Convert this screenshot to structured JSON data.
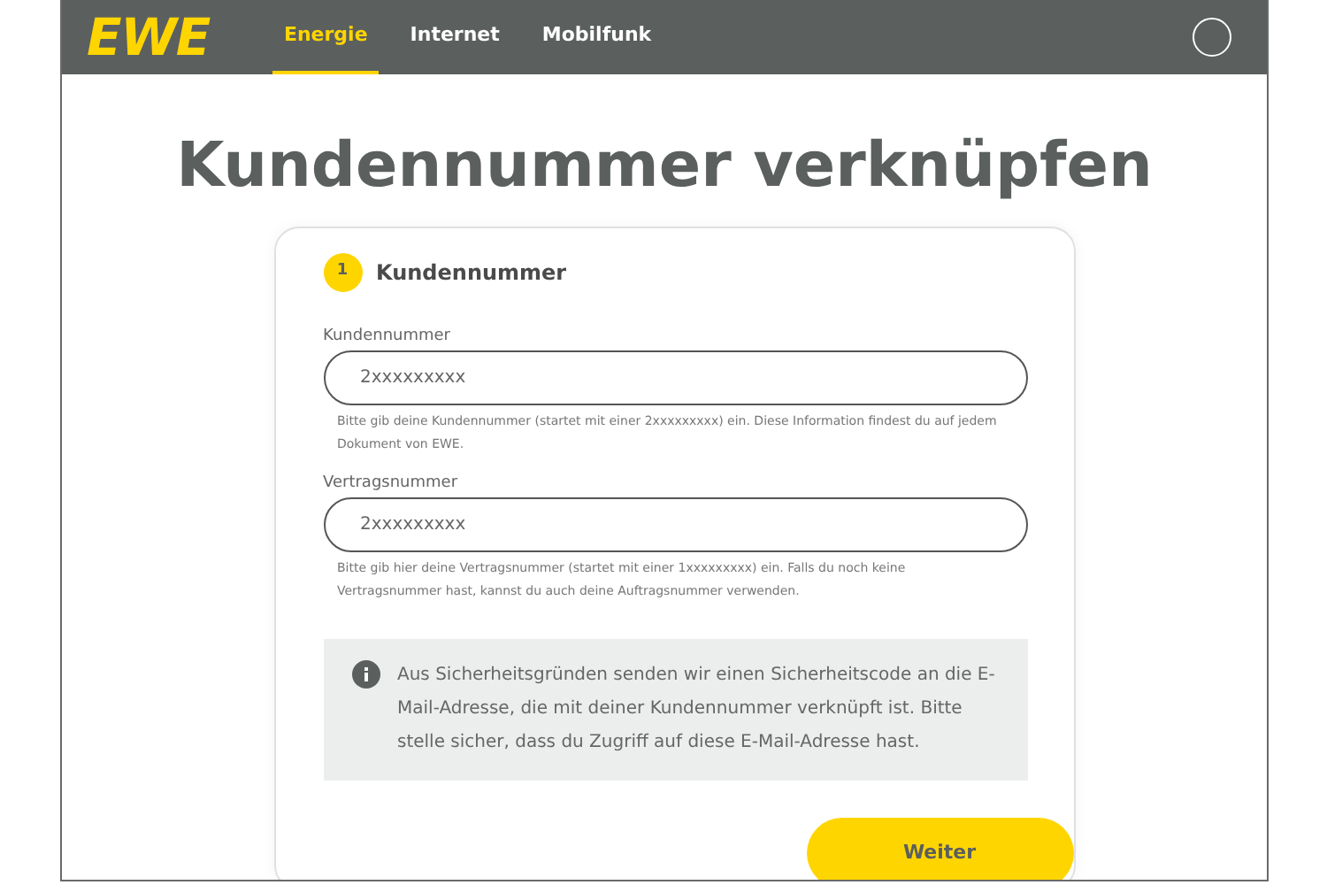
{
  "header": {
    "logo": "EWE",
    "tabs": [
      {
        "label": "Energie",
        "selected": true
      },
      {
        "label": "Internet",
        "selected": false
      },
      {
        "label": "Mobilfunk",
        "selected": false
      }
    ]
  },
  "title": "Kundennummer verknüpfen",
  "step": {
    "number": "1",
    "title": "Kundennummer"
  },
  "fields": [
    {
      "label": "Kundennummer",
      "placeholder": "2xxxxxxxxx",
      "hint": "Bitte gib deine Kundennummer (startet mit einer 2xxxxxxxxx) ein. Diese Information findest du auf jedem Dokument von EWE."
    },
    {
      "label": "Vertragsnummer",
      "placeholder": "2xxxxxxxxx",
      "hint": "Bitte gib hier deine Vertragsnummer (startet mit einer 1xxxxxxxxx) ein. Falls du noch keine Vertragsnummer hast, kannst du auch deine Auftragsnummer verwenden."
    }
  ],
  "info": "Aus Sicherheitsgründen senden wir einen Sicherheitscode an die E-Mail-Adresse, die mit deiner Kundennummer verknüpft ist. Bitte stelle sicher, dass du Zugriff auf diese E-Mail-Adresse hast.",
  "button": "Weiter"
}
